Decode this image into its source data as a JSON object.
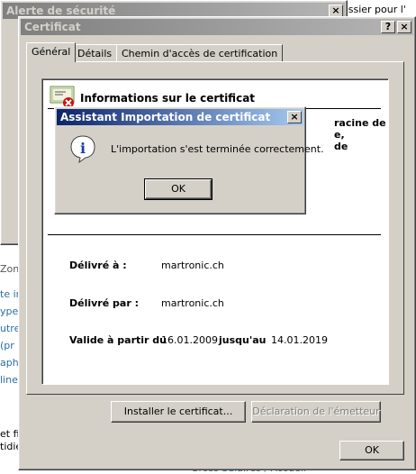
{
  "background": {
    "top_right_text": "ossier pour l'",
    "left_links": [
      "te in",
      "ype",
      "utre",
      "(pr",
      "aph",
      "line"
    ],
    "left_text_1": "Zone",
    "left_text_2": "et fi",
    "left_text_3": "tidie",
    "bottom_text": "Gross Salaires / Accueil"
  },
  "security_alert": {
    "title": "Alerte de sécurité",
    "close_glyph": "×"
  },
  "cert_window": {
    "title": "Certificat",
    "help_glyph": "?",
    "close_glyph": "×",
    "tabs": [
      "Général",
      "Détails",
      "Chemin d'accès de certification"
    ],
    "info_heading": "Informations sur le certificat",
    "partial_right_1": "racine de",
    "partial_right_2": "e,",
    "partial_right_3": "de",
    "issued_to_label": "Délivré à :",
    "issued_to_value": "martronic.ch",
    "issued_by_label": "Délivré par :",
    "issued_by_value": "martronic.ch",
    "valid_from_label": "Valide à partir du",
    "valid_from_value": "16.01.2009",
    "valid_to_label": "jusqu'au",
    "valid_to_value": "14.01.2019",
    "install_button": "Installer le certificat...",
    "issuer_statement_button": "Déclaration de l'émetteur",
    "ok_button": "OK"
  },
  "import_dialog": {
    "title": "Assistant Importation de certificat",
    "close_glyph": "×",
    "message": "L'importation s'est terminée correctement.",
    "ok_button": "OK",
    "icon_glyph": "i"
  }
}
